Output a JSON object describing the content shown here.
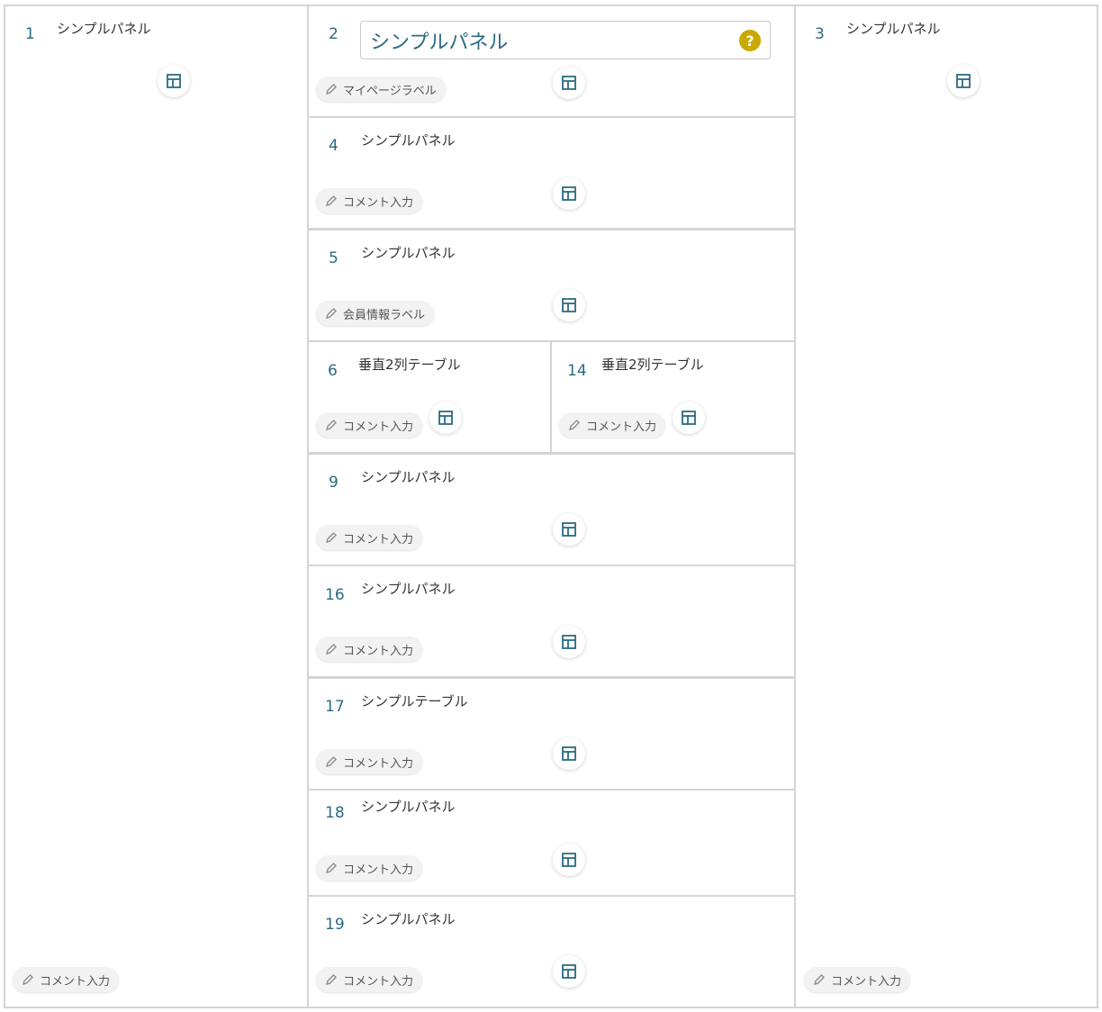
{
  "colors": {
    "accent": "#2a6b82",
    "border": "#d4d4d4",
    "help": "#c9a800",
    "chip_bg": "#f2f2f2"
  },
  "icons": {
    "layout": "layout-icon",
    "pencil": "pencil-icon",
    "help": "help-icon"
  },
  "help_symbol": "?",
  "title_input_value": "シンプルパネル",
  "panels": [
    {
      "num": "1",
      "title": "シンプルパネル",
      "chip": "コメント入力"
    },
    {
      "num": "2",
      "title": "",
      "chip": "マイページラベル"
    },
    {
      "num": "3",
      "title": "シンプルパネル",
      "chip": "コメント入力"
    },
    {
      "num": "4",
      "title": "シンプルパネル",
      "chip": "コメント入力"
    },
    {
      "num": "5",
      "title": "シンプルパネル",
      "chip": "会員情報ラベル"
    },
    {
      "num": "6",
      "title": "垂直2列テーブル",
      "chip": "コメント入力"
    },
    {
      "num": "14",
      "title": "垂直2列テーブル",
      "chip": "コメント入力"
    },
    {
      "num": "9",
      "title": "シンプルパネル",
      "chip": "コメント入力"
    },
    {
      "num": "16",
      "title": "シンプルパネル",
      "chip": "コメント入力"
    },
    {
      "num": "17",
      "title": "シンプルテーブル",
      "chip": "コメント入力"
    },
    {
      "num": "18",
      "title": "シンプルパネル",
      "chip": "コメント入力"
    },
    {
      "num": "19",
      "title": "シンプルパネル",
      "chip": "コメント入力"
    }
  ]
}
